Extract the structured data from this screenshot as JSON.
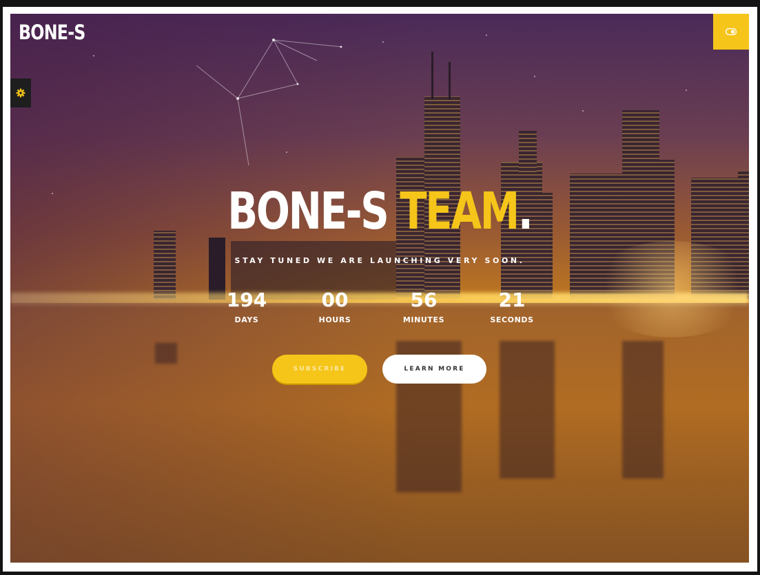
{
  "brand": {
    "logo_text": "BONE-S"
  },
  "hero": {
    "headline_main": "BONE-S",
    "headline_accent": "TEAM",
    "headline_dot": ".",
    "tagline": "STAY TUNED WE ARE LAUNCHING VERY SOON."
  },
  "countdown": [
    {
      "value": "194",
      "label": "DAYS"
    },
    {
      "value": "00",
      "label": "HOURS"
    },
    {
      "value": "56",
      "label": "MINUTES"
    },
    {
      "value": "21",
      "label": "SECONDS"
    }
  ],
  "buttons": {
    "subscribe_label": "SUBSCRIBE",
    "learn_more_label": "LEARN MORE"
  },
  "icons": {
    "settings": "gear-icon",
    "toggle": "toggle-switch-icon"
  },
  "colors": {
    "accent": "#f5c51a",
    "text_light": "#ffffff",
    "panel_dark": "#1e1e1e"
  }
}
